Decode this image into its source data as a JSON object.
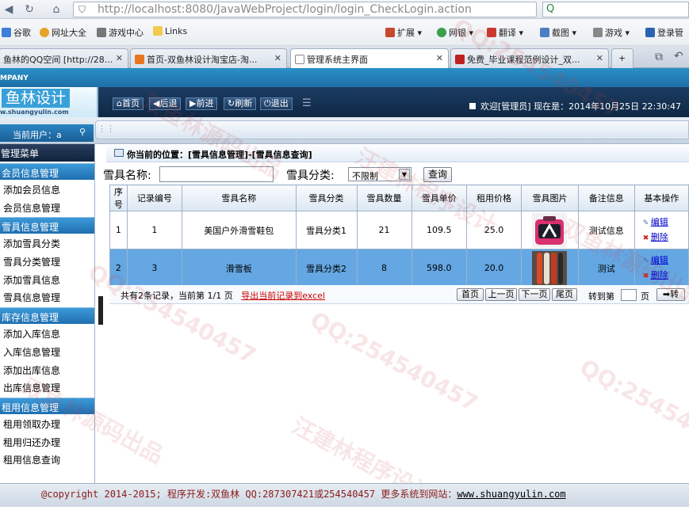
{
  "browser": {
    "url_host": "http://localhost",
    "url_rest": ":8080/JavaWebProject/login/login_CheckLogin.action",
    "bookmarks": [
      "谷歌",
      "网址大全",
      "游戏中心",
      "Links",
      "扩展",
      "网银",
      "翻译",
      "截图",
      "游戏",
      "登录管"
    ],
    "tabs": [
      {
        "label": "鱼林的QQ空间 [http://28..."
      },
      {
        "label": "首页-双鱼林设计淘宝店-淘..."
      },
      {
        "label": "管理系统主界面"
      },
      {
        "label": "免费_毕业课程范例设计_双..."
      }
    ]
  },
  "app": {
    "company": "MPANY",
    "logo_text": "鱼林设计",
    "logo_url": "w.shuangyulin.com",
    "nav": [
      "首页",
      "后退",
      "前进",
      "刷新",
      "退出"
    ],
    "welcome": "欢迎[管理员]  现在是：2014年10月25日 22:30:47",
    "current_user": "当前用户：a"
  },
  "sidebar": {
    "title": "管理菜单",
    "groups": [
      {
        "title": "会员信息管理",
        "items": [
          "添加会员信息",
          "会员信息管理"
        ]
      },
      {
        "title": "雪具信息管理",
        "items": [
          "添加雪具分类",
          "雪具分类管理",
          "添加雪具信息",
          "雪具信息管理"
        ]
      },
      {
        "title": "库存信息管理",
        "items": [
          "添加入库信息",
          "入库信息管理",
          "添加出库信息",
          "出库信息管理"
        ]
      },
      {
        "title": "租用信息管理",
        "items": [
          "租用领取办理",
          "租用归还办理",
          "租用信息查询"
        ]
      }
    ]
  },
  "main": {
    "breadcrumb": "你当前的位置：[雪具信息管理]-[雪具信息查询]",
    "search": {
      "name_label": "雪具名称:",
      "name_value": "",
      "category_label": "雪具分类:",
      "category_value": "不限制",
      "query_button": "查询"
    },
    "columns": [
      "序号",
      "记录编号",
      "雪具名称",
      "雪具分类",
      "雪具数量",
      "雪具单价",
      "租用价格",
      "雪具图片",
      "备注信息",
      "基本操作"
    ],
    "rows": [
      {
        "seq": "1",
        "id": "1",
        "name": "美国户外滑雪鞋包",
        "category": "雪具分类1",
        "qty": "21",
        "price": "109.5",
        "rent": "25.0",
        "photo": "bag-photo",
        "note": "测试信息",
        "edit": "编辑",
        "delete": "删除"
      },
      {
        "seq": "2",
        "id": "3",
        "name": "滑雪板",
        "category": "雪具分类2",
        "qty": "8",
        "price": "598.0",
        "rent": "20.0",
        "photo": "skis-photo",
        "note": "测试",
        "edit": "编辑",
        "delete": "删除"
      }
    ],
    "pager": {
      "info": "共有2条记录，当前第 1/1 页",
      "export": "导出当前记录到excel",
      "first": "首页",
      "prev": "上一页",
      "next": "下一页",
      "last": "尾页",
      "goto_label": "转到第",
      "page_unit": "页",
      "go": "转"
    }
  },
  "footer": {
    "copyright": "@copyright 2014-2015; 程序开发:双鱼林  QQ:287307421或254540457  更多系统到网站：",
    "site": "www.shuangyulin.com"
  },
  "watermark": [
    "QQ:254540457",
    "汪建林程序设计",
    "双鱼林源码出品"
  ],
  "colors": {
    "header_blue": "#1e6fa6",
    "dark_nav": "#0e2744",
    "selected_row": "#64a7e3",
    "footer_text": "#8b1a1a"
  }
}
